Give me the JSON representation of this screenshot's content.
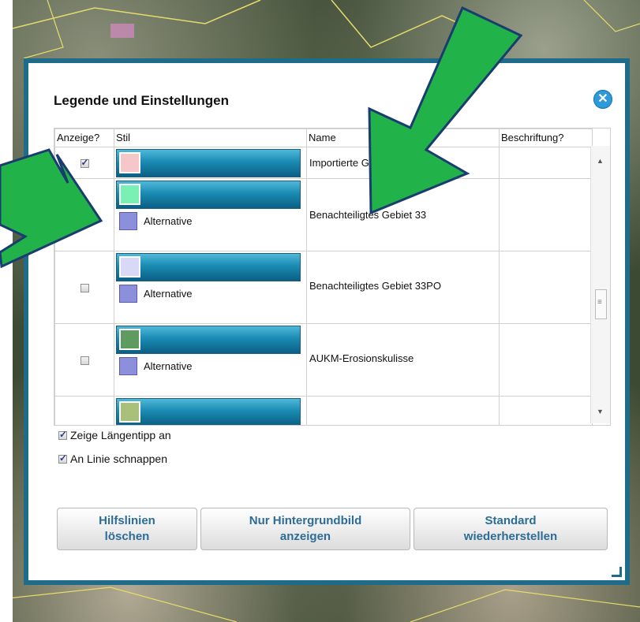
{
  "dialog": {
    "title": "Legende und Einstellungen",
    "close_label": "✕"
  },
  "table": {
    "headers": [
      "Anzeige?",
      "Stil",
      "Name",
      "Beschriftung?"
    ],
    "rows": [
      {
        "shown": true,
        "swatch_color": "#f5c7c9",
        "alternative": "",
        "name": "Importierte G"
      },
      {
        "shown": false,
        "swatch_color": "#7af0b4",
        "alternative": "Alternative",
        "name": "Benachteiligtes Gebiet 33"
      },
      {
        "shown": false,
        "swatch_color": "#d7d9f6",
        "alternative": "Alternative",
        "name": "Benachteiligtes Gebiet 33PO"
      },
      {
        "shown": false,
        "swatch_color": "#5f9a60",
        "alternative": "Alternative",
        "name": "AUKM-Erosionskulisse"
      },
      {
        "shown": false,
        "swatch_color": "#a8c07a",
        "alternative": "",
        "name": ""
      }
    ]
  },
  "options": {
    "length_tip": "Zeige Längentipp an",
    "snap_line": "An Linie schnappen"
  },
  "buttons": {
    "clear_guides": "Hilfslinien\nlöschen",
    "background_only": "Nur Hintergrundbild\nanzeigen",
    "restore_default": "Standard\nwiederherstellen"
  },
  "colors": {
    "arrow": "#21b24a",
    "frame": "#1f6b8a",
    "button_text": "#2d6d95"
  }
}
